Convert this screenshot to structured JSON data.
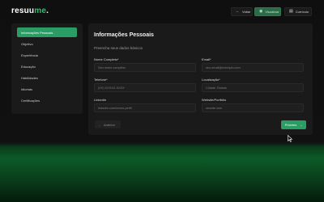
{
  "header": {
    "logo_main": "resuu",
    "logo_accent": "me",
    "logo_dot": ".",
    "back_label": "Voltar",
    "editor_label": "Visualizar",
    "curriculum_label": "Currículo"
  },
  "sidebar": {
    "items": [
      {
        "label": "Informações Pessoais"
      },
      {
        "label": "Objetivo"
      },
      {
        "label": "Experiência"
      },
      {
        "label": "Educação"
      },
      {
        "label": "Habilidades"
      },
      {
        "label": "Idiomas"
      },
      {
        "label": "Certificações"
      }
    ]
  },
  "main": {
    "title": "Informações Pessoais",
    "subtitle": "Preencha seus dados básicos",
    "fields": {
      "name": {
        "label": "Nome Completo*",
        "placeholder": "Seu nome completo"
      },
      "email": {
        "label": "Email*",
        "placeholder": "seu.email@exemplo.com"
      },
      "phone": {
        "label": "Telefone*",
        "placeholder": "(XX) XXXXX-XXXX"
      },
      "location": {
        "label": "Localização*",
        "placeholder": "Cidade, Estado"
      },
      "linkedin": {
        "label": "LinkedIn",
        "placeholder": "linkedin.com/in/seu-perfil"
      },
      "website": {
        "label": "Website/Portfólio",
        "placeholder": "seusite.com"
      }
    },
    "prev_label": "Anterior",
    "next_label": "Próximo"
  },
  "colors": {
    "accent": "#2a9d64",
    "panel": "#1a1a1a",
    "background": "#111111"
  },
  "icons": {
    "back": "arrow-left-icon",
    "editor": "eye-icon",
    "curriculum": "document-icon",
    "next": "arrow-right-icon",
    "prev": "arrow-left-icon"
  }
}
